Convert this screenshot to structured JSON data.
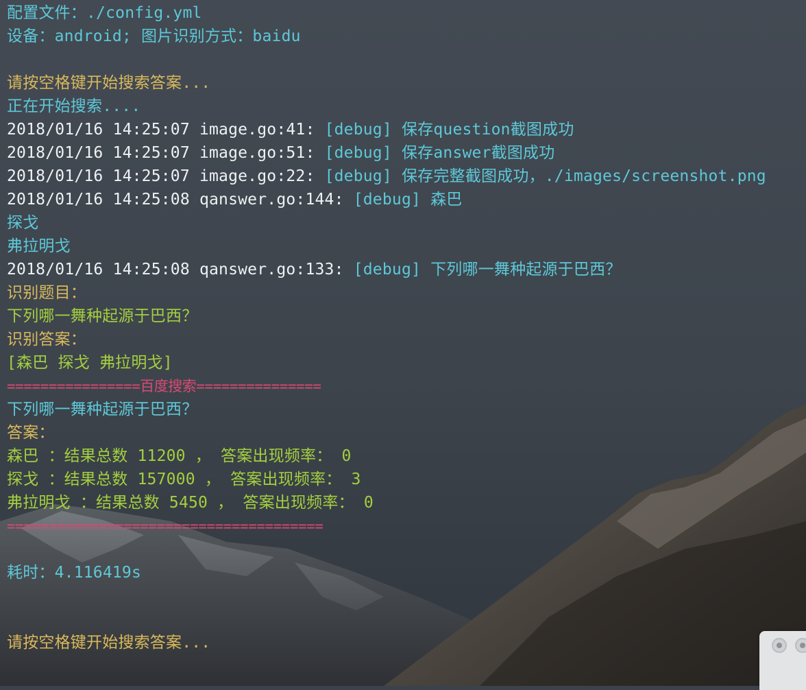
{
  "terminal": {
    "config_line": "配置文件：./config.yml",
    "device_line": "设备：android; 图片识别方式：baidu",
    "prompt_line_1": "请按空格键开始搜索答案...",
    "searching_line": "正在开始搜索....",
    "logs": [
      {
        "prefix": "2018/01/16 14:25:07 image.go:41: ",
        "tag": "[debug]",
        "message": " 保存question截图成功"
      },
      {
        "prefix": "2018/01/16 14:25:07 image.go:51: ",
        "tag": "[debug]",
        "message": " 保存answer截图成功"
      },
      {
        "prefix": "2018/01/16 14:25:07 image.go:22: ",
        "tag": "[debug]",
        "message": " 保存完整截图成功，./images/screenshot.png"
      },
      {
        "prefix": "2018/01/16 14:25:08 qanswer.go:144: ",
        "tag": "[debug]",
        "message": " 森巴"
      }
    ],
    "option_line_2": "探戈",
    "option_line_3": "弗拉明戈",
    "log_question": {
      "prefix": "2018/01/16 14:25:08 qanswer.go:133: ",
      "tag": "[debug]",
      "message": " 下列哪一舞种起源于巴西？"
    },
    "recognized_question_label": "识别题目：",
    "recognized_question": "下列哪一舞种起源于巴西？",
    "recognized_answers_label": "识别答案：",
    "recognized_answers": "[森巴 探戈 弗拉明戈]",
    "baidu_header": "================百度搜索===============",
    "search_question": "下列哪一舞种起源于巴西？",
    "answers_label": "答案：",
    "results": [
      "森巴 ：结果总数 11200 ， 答案出现频率： 0",
      "探戈 ：结果总数 157000 ， 答案出现频率： 3",
      "弗拉明戈 ：结果总数 5450 ， 答案出现频率： 0"
    ],
    "footer_rule": "======================================",
    "elapsed": "耗时：4.116419s",
    "prompt_line_2": "请按空格键开始搜索答案..."
  },
  "colors": {
    "cyan": "#5ec8d8",
    "yellow": "#d9b95c",
    "white": "#eef2f4",
    "green": "#a3cf3f",
    "red": "#d94a73",
    "background": "#3b424b"
  },
  "icons": {
    "background": "mountain-wallpaper",
    "corner_widget": "window-control-dots"
  }
}
